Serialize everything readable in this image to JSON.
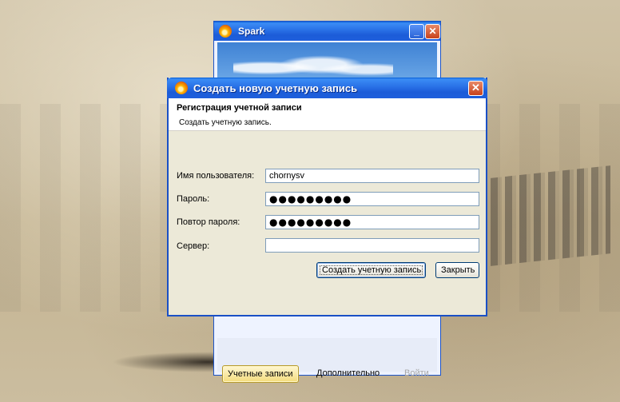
{
  "spark_window": {
    "title": "Spark",
    "minimize_glyph": "_",
    "close_glyph": "✕",
    "tabs": [
      {
        "label": "Учетные записи",
        "state": "active"
      },
      {
        "label": "Дополнительно",
        "state": "normal"
      },
      {
        "label": "Войти",
        "state": "disabled"
      }
    ]
  },
  "dialog": {
    "title": "Создать новую учетную запись",
    "close_glyph": "✕",
    "heading": "Регистрация учетной записи",
    "subheading": "Создать учетную запись.",
    "fields": {
      "username": {
        "label": "Имя пользователя:",
        "value": "chornysv"
      },
      "password": {
        "label": "Пароль:",
        "value": "●●●●●●●●●"
      },
      "confirm": {
        "label": "Повтор пароля:",
        "value": "●●●●●●●●●"
      },
      "server": {
        "label": "Сервер:",
        "value": ""
      }
    },
    "buttons": {
      "create": "Создать учетную запись",
      "close": "Закрыть"
    }
  },
  "colors": {
    "titlebar_blue": "#2b74e8",
    "dialog_face": "#ece9d8",
    "field_border": "#7f9db9",
    "close_red": "#c8421c",
    "active_tab_gold": "#f4dc7c"
  },
  "icons": {
    "app_logo": "spark-flame-icon",
    "minimize": "minimize-icon",
    "close": "close-icon"
  }
}
